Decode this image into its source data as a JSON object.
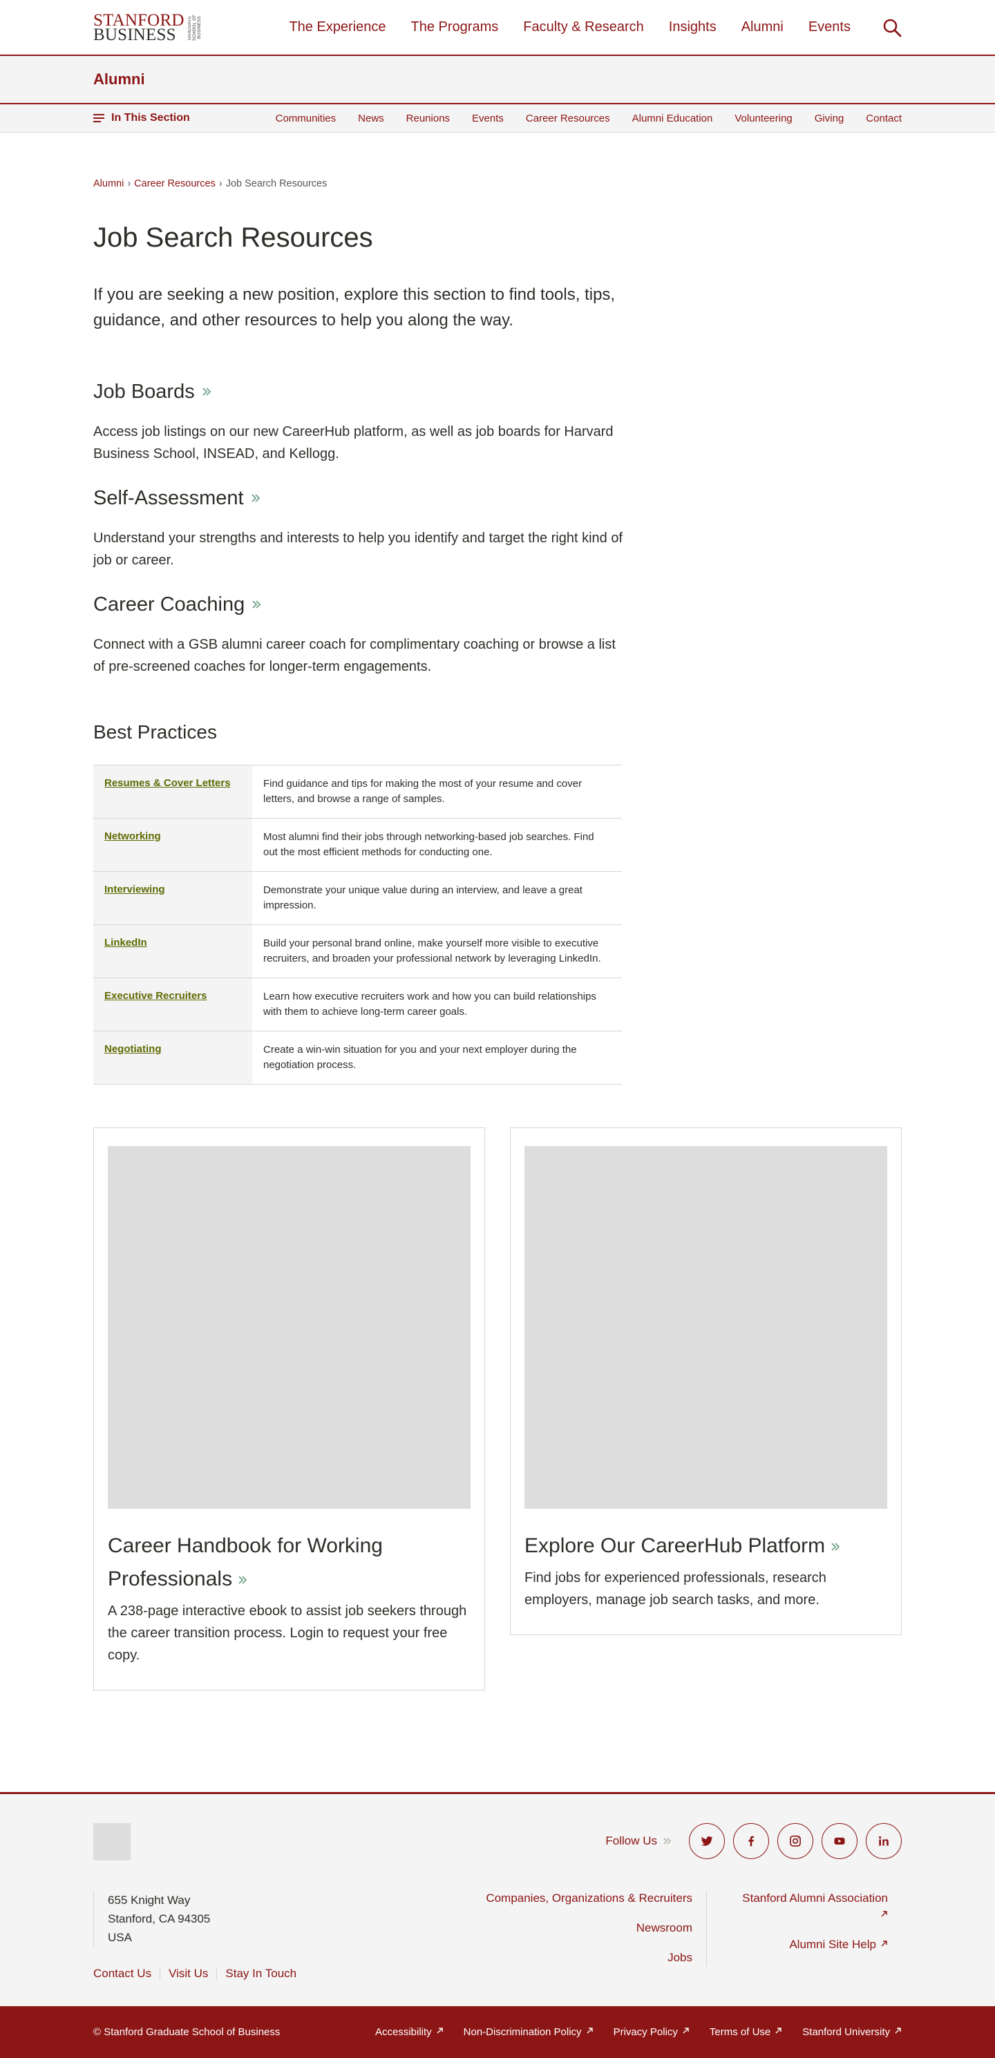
{
  "header": {
    "logo_line1": "STANFORD",
    "logo_line2": "BUSINESS",
    "logo_side": "GRADUATE SCHOOL OF BUSINESS",
    "nav": [
      "The Experience",
      "The Programs",
      "Faculty & Research",
      "Insights",
      "Alumni",
      "Events"
    ]
  },
  "section": {
    "title": "Alumni",
    "in_section_label": "In This Section",
    "links": [
      "Communities",
      "News",
      "Reunions",
      "Events",
      "Career Resources",
      "Alumni Education",
      "Volunteering",
      "Giving",
      "Contact"
    ]
  },
  "breadcrumb": {
    "items": [
      "Alumni",
      "Career Resources"
    ],
    "current": "Job Search Resources",
    "separator": "›"
  },
  "page": {
    "title": "Job Search Resources",
    "intro": "If you are seeking a new position, explore this section to find tools, tips, guidance, and other resources to help you along the way."
  },
  "resources": [
    {
      "title": "Job Boards",
      "description": "Access job listings on our new CareerHub platform, as well as job boards for Harvard Business School, INSEAD, and Kellogg."
    },
    {
      "title": "Self-Assessment",
      "description": "Understand your strengths and interests to help you identify and target the right kind of job or career."
    },
    {
      "title": "Career Coaching",
      "description": "Connect with a GSB alumni career coach for complimentary coaching or browse a list of pre-screened coaches for longer-term engagements."
    }
  ],
  "best_practices": {
    "title": "Best Practices",
    "rows": [
      {
        "label": "Resumes & Cover Letters",
        "text": "Find guidance and tips for making the most of your resume and cover letters, and browse a range of samples."
      },
      {
        "label": "Networking",
        "text": "Most alumni find their jobs through networking-based job searches. Find out the most efficient methods for conducting one."
      },
      {
        "label": "Interviewing",
        "text": "Demonstrate your unique value during an interview, and leave a great impression."
      },
      {
        "label": "LinkedIn",
        "text": "Build your personal brand online, make yourself more visible to executive recruiters, and broaden your professional network by leveraging LinkedIn."
      },
      {
        "label": "Executive Recruiters",
        "text": "Learn how executive recruiters work and how you can build relationships with them to achieve long-term career goals."
      },
      {
        "label": "Negotiating",
        "text": "Create a win-win situation for you and your next employer during the negotiation process."
      }
    ]
  },
  "cards": [
    {
      "title": "Career Handbook for Working Professionals",
      "description": "A 238-page interactive ebook to assist job seekers through the career transition process. Login to request your free copy."
    },
    {
      "title": "Explore Our CareerHub Platform",
      "description": "Find jobs for experienced professionals, research employers, manage job search tasks, and more."
    }
  ],
  "footer": {
    "follow_label": "Follow Us",
    "social_icons": [
      "twitter-icon",
      "facebook-icon",
      "instagram-icon",
      "youtube-icon",
      "linkedin-icon"
    ],
    "address": [
      "655 Knight Way",
      "Stanford, CA 94305",
      "USA"
    ],
    "links": [
      "Contact Us",
      "Visit Us",
      "Stay In Touch"
    ],
    "mid_links": [
      "Companies, Organizations & Recruiters",
      "Newsroom",
      "Jobs"
    ],
    "right_links": [
      "Stanford Alumni Association",
      "Alumni Site Help"
    ]
  },
  "bottom": {
    "copyright": "© Stanford Graduate School of Business",
    "links": [
      "Accessibility",
      "Non-Discrimination Policy",
      "Privacy Policy",
      "Terms of Use",
      "Stanford University"
    ]
  },
  "colors": {
    "brand": "#8c1515",
    "link_accent": "#5e6a03",
    "chevron": "#6fa287",
    "light_bg": "#f4f4f4",
    "placeholder": "#dddddd"
  }
}
